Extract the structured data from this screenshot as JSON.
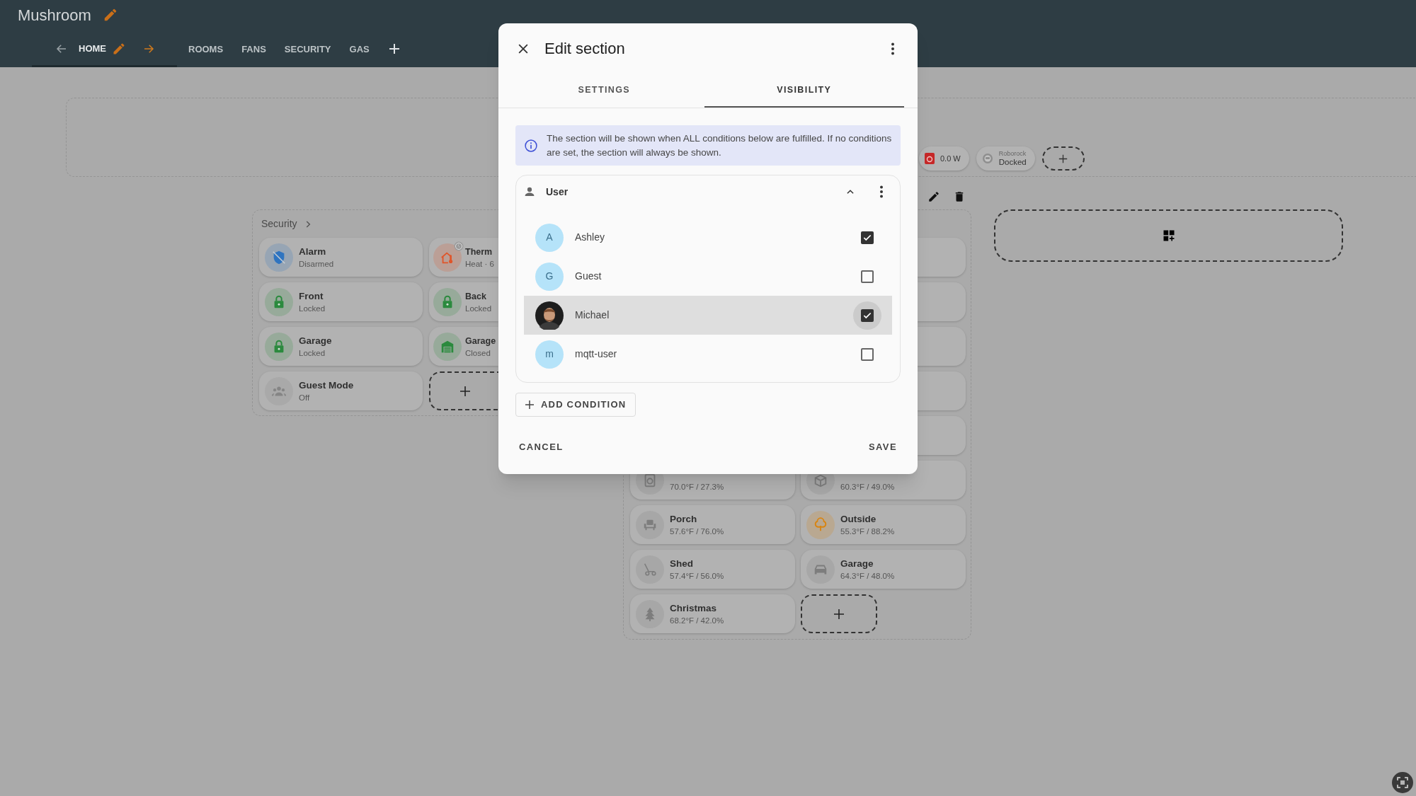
{
  "header": {
    "title": "Mushroom",
    "views": [
      {
        "label": "HOME",
        "selected": true
      },
      {
        "label": "ROOMS",
        "selected": false
      },
      {
        "label": "FANS",
        "selected": false
      },
      {
        "label": "SECURITY",
        "selected": false
      },
      {
        "label": "GAS",
        "selected": false
      }
    ]
  },
  "badges": [
    {
      "kind": "power",
      "label": "0.0 W"
    },
    {
      "kind": "vacuum",
      "caption": "Roborock",
      "label": "Docked"
    }
  ],
  "security_section": {
    "title": "Security",
    "cards": [
      {
        "name": "Alarm",
        "state": "Disarmed",
        "color": "#2f74c0"
      },
      {
        "name": "Therm",
        "state": "Heat · 6",
        "color": "#e0552a"
      },
      {
        "name": "Front",
        "state": "Locked",
        "color": "#2b8a3e"
      },
      {
        "name": "Back",
        "state": "Locked",
        "color": "#2b8a3e"
      },
      {
        "name": "Garage",
        "state": "Locked",
        "color": "#2b8a3e"
      },
      {
        "name": "Garage",
        "state": "Closed",
        "color": "#2b8a3e"
      },
      {
        "name": "Guest Mode",
        "state": "Off",
        "color": "#858585"
      }
    ]
  },
  "climate_section": {
    "cards": [
      {
        "state": "70.0°F / 27.3%",
        "color": "#7d7d7d"
      },
      {
        "state": "60.3°F / 49.0%",
        "color": "#7d7d7d"
      },
      {
        "name": "Porch",
        "state": "57.6°F / 76.0%",
        "color": "#7d7d7d"
      },
      {
        "name": "Outside",
        "state": "55.3°F / 88.2%",
        "color": "#d9840f"
      },
      {
        "name": "Shed",
        "state": "57.4°F / 56.0%",
        "color": "#7d7d7d"
      },
      {
        "name": "Garage",
        "state": "64.3°F / 48.0%",
        "color": "#7d7d7d"
      },
      {
        "name": "Christmas",
        "state": "68.2°F / 42.0%",
        "color": "#7d7d7d"
      }
    ]
  },
  "dialog": {
    "title": "Edit section",
    "tabs": [
      {
        "label": "SETTINGS",
        "selected": false
      },
      {
        "label": "VISIBILITY",
        "selected": true
      }
    ],
    "info": "The section will be shown when ALL conditions below are fulfilled. If no conditions are set, the section will always be shown.",
    "condition": {
      "title": "User",
      "expanded": true,
      "users": [
        {
          "kind": "initial",
          "initial": "A",
          "name": "Ashley",
          "checked": true,
          "hovered": false
        },
        {
          "kind": "initial",
          "initial": "G",
          "name": "Guest",
          "checked": false,
          "hovered": false
        },
        {
          "kind": "photo",
          "name": "Michael",
          "checked": true,
          "hovered": true
        },
        {
          "kind": "initial",
          "initial": "m",
          "name": "mqtt-user",
          "checked": false,
          "hovered": false
        }
      ]
    },
    "add_condition": "ADD CONDITION",
    "cancel": "CANCEL",
    "save": "SAVE"
  }
}
